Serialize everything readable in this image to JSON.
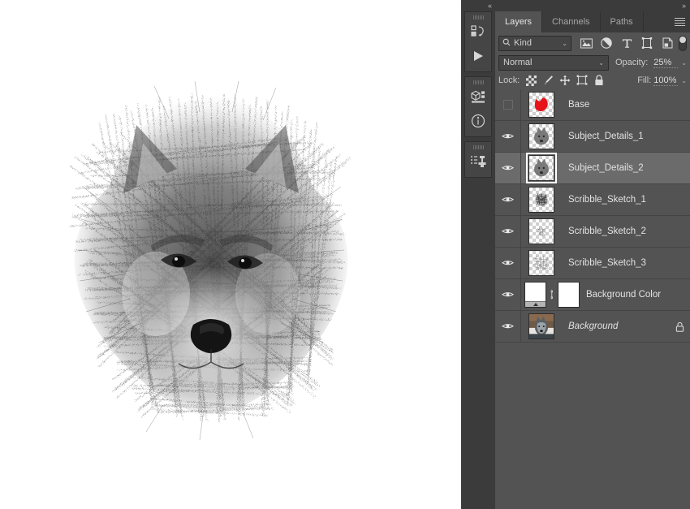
{
  "app": {
    "name": "Adobe Photoshop",
    "panel_background": "#535353",
    "header_background": "#3b3b3b",
    "selected_row_background": "#6b6b6b",
    "accent_red": "#e8121b"
  },
  "dock": {
    "collapse_label": "«",
    "groups": [
      {
        "buttons": [
          {
            "icon": "history-icon",
            "label": "History"
          },
          {
            "icon": "play-icon",
            "label": "Play"
          }
        ]
      },
      {
        "buttons": [
          {
            "icon": "3d-icon",
            "label": "3D"
          },
          {
            "icon": "info-icon",
            "label": "Info"
          }
        ]
      },
      {
        "buttons": [
          {
            "icon": "clone-source-icon",
            "label": "Clone Source"
          }
        ]
      }
    ]
  },
  "panel": {
    "collapse_label": "»",
    "menu_icon": "hamburger-menu-icon",
    "tabs": [
      {
        "label": "Layers",
        "active": true
      },
      {
        "label": "Channels",
        "active": false
      },
      {
        "label": "Paths",
        "active": false
      }
    ],
    "filter": {
      "icon": "search-icon",
      "kind_label": "Kind",
      "caret": "⌄",
      "type_filters": [
        {
          "icon": "pixel-layer-filter-icon",
          "label": "Filter for pixel layers"
        },
        {
          "icon": "adjustment-layer-filter-icon",
          "label": "Filter for adjustment layers"
        },
        {
          "icon": "type-layer-filter-icon",
          "label": "Filter for type layers"
        },
        {
          "icon": "shape-layer-filter-icon",
          "label": "Filter for shape layers"
        },
        {
          "icon": "smart-object-filter-icon",
          "label": "Filter for smart objects"
        }
      ],
      "toggle_label": "Turn layer filtering on/off"
    },
    "blend": {
      "mode": "Normal",
      "opacity_label": "Opacity:",
      "opacity_value": "25%",
      "fill_label": "Fill:",
      "fill_value": "100%"
    },
    "lock": {
      "label": "Lock:",
      "items": [
        {
          "icon": "lock-transparent-pixels-icon",
          "label": "Lock transparent pixels"
        },
        {
          "icon": "lock-image-pixels-icon",
          "label": "Lock image pixels"
        },
        {
          "icon": "lock-position-icon",
          "label": "Lock position"
        },
        {
          "icon": "lock-artboard-nesting-icon",
          "label": "Prevent auto-nesting"
        },
        {
          "icon": "lock-all-icon",
          "label": "Lock all"
        }
      ]
    },
    "layers": [
      {
        "name": "Base",
        "visible": false,
        "selected": false,
        "thumb": "red-shape",
        "locked": false,
        "italic": false
      },
      {
        "name": "Subject_Details_1",
        "visible": true,
        "selected": false,
        "thumb": "wolf-sketch",
        "locked": false,
        "italic": false
      },
      {
        "name": "Subject_Details_2",
        "visible": true,
        "selected": true,
        "thumb": "wolf-sketch",
        "locked": false,
        "italic": false
      },
      {
        "name": "Scribble_Sketch_1",
        "visible": true,
        "selected": false,
        "thumb": "scribble-dark",
        "locked": false,
        "italic": false
      },
      {
        "name": "Scribble_Sketch_2",
        "visible": true,
        "selected": false,
        "thumb": "scribble-light",
        "locked": false,
        "italic": false
      },
      {
        "name": "Scribble_Sketch_3",
        "visible": true,
        "selected": false,
        "thumb": "scribble-mid",
        "locked": false,
        "italic": false
      },
      {
        "name": "Background Color",
        "visible": true,
        "selected": false,
        "thumb": "gradient-fill-with-mask",
        "locked": false,
        "italic": false
      },
      {
        "name": "Background",
        "visible": true,
        "selected": false,
        "thumb": "wolf-photo",
        "locked": true,
        "italic": true
      }
    ]
  },
  "canvas": {
    "artwork_title": "Scribble sketch wolf portrait",
    "background_color": "#ffffff"
  }
}
